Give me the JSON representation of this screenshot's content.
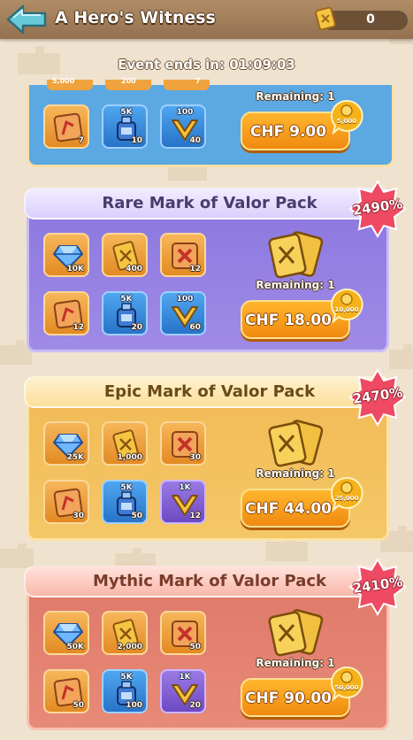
{
  "header": {
    "title": "A Hero's Witness",
    "currency_value": "0"
  },
  "event": {
    "timer_text": "Event ends in: 01:09:03"
  },
  "top_pack": {
    "partial_quantities": [
      "5,000",
      "200",
      "7"
    ],
    "items": [
      {
        "icon": "scroll-icon",
        "quantity": "7",
        "color": "orange"
      },
      {
        "icon": "potion-icon",
        "top": "5K",
        "quantity": "10",
        "color": "blue"
      },
      {
        "icon": "valor-mark-icon",
        "top": "100",
        "quantity": "40",
        "color": "blue"
      }
    ],
    "remaining": "Remaining: 1",
    "price": "CHF 9.00",
    "coin_bonus": "5,000"
  },
  "packs": [
    {
      "title": "Rare Mark of Valor Pack",
      "discount": "2490%",
      "items": [
        {
          "icon": "diamond-icon",
          "quantity": "10K",
          "color": "orange"
        },
        {
          "icon": "token-icon",
          "quantity": "400",
          "color": "orange"
        },
        {
          "icon": "red-scroll-icon",
          "quantity": "12",
          "color": "orange"
        },
        {
          "icon": "scroll-icon",
          "quantity": "12",
          "color": "orange"
        },
        {
          "icon": "potion-icon",
          "top": "5K",
          "quantity": "20",
          "color": "blue"
        },
        {
          "icon": "valor-mark-icon",
          "top": "100",
          "quantity": "60",
          "color": "blue"
        }
      ],
      "remaining": "Remaining: 1",
      "price": "CHF 18.00",
      "coin_bonus": "10,000"
    },
    {
      "title": "Epic Mark of Valor Pack",
      "discount": "2470%",
      "items": [
        {
          "icon": "diamond-icon",
          "quantity": "25K",
          "color": "orange"
        },
        {
          "icon": "token-icon",
          "quantity": "1,000",
          "color": "orange"
        },
        {
          "icon": "red-scroll-icon",
          "quantity": "30",
          "color": "orange"
        },
        {
          "icon": "scroll-icon",
          "quantity": "30",
          "color": "orange"
        },
        {
          "icon": "potion-icon",
          "top": "5K",
          "quantity": "50",
          "color": "blue"
        },
        {
          "icon": "valor-mark-icon",
          "top": "1K",
          "quantity": "12",
          "color": "purple"
        }
      ],
      "remaining": "Remaining: 1",
      "price": "CHF 44.00",
      "coin_bonus": "25,000"
    },
    {
      "title": "Mythic Mark of Valor Pack",
      "discount": "2410%",
      "items": [
        {
          "icon": "diamond-icon",
          "quantity": "50K",
          "color": "orange"
        },
        {
          "icon": "token-icon",
          "quantity": "2,000",
          "color": "orange"
        },
        {
          "icon": "red-scroll-icon",
          "quantity": "50",
          "color": "orange"
        },
        {
          "icon": "scroll-icon",
          "quantity": "50",
          "color": "orange"
        },
        {
          "icon": "potion-icon",
          "top": "5K",
          "quantity": "100",
          "color": "blue"
        },
        {
          "icon": "valor-mark-icon",
          "top": "1K",
          "quantity": "20",
          "color": "purple"
        }
      ],
      "remaining": "Remaining: 1",
      "price": "CHF 90.00",
      "coin_bonus": "50,000"
    }
  ]
}
